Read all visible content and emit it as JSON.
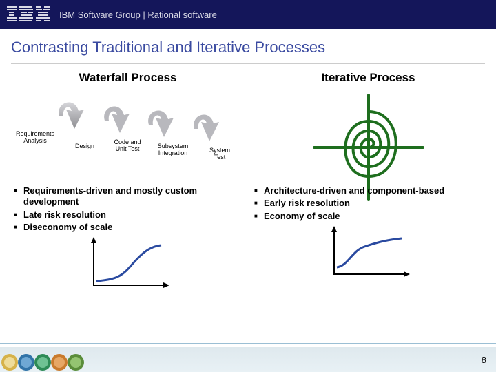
{
  "header": {
    "brand": "IBM",
    "text": "IBM Software Group | Rational software"
  },
  "title": "Contrasting Traditional and Iterative Processes",
  "columns": {
    "left": {
      "heading": "Waterfall Process",
      "phases": [
        "Requirements\nAnalysis",
        "Design",
        "Code and\nUnit Test",
        "Subsystem\nIntegration",
        "System\nTest"
      ],
      "bullets": [
        "Requirements-driven and mostly custom development",
        "Late risk resolution",
        "Diseconomy of scale"
      ]
    },
    "right": {
      "heading": "Iterative Process",
      "bullets": [
        "Architecture-driven and component-based",
        "Early risk resolution",
        "Economy of scale"
      ]
    }
  },
  "page_number": "8",
  "colors": {
    "header_bg": "#14165a",
    "title": "#3a4aa0",
    "spiral": "#1e6e1e",
    "arrow": "#8f8f93",
    "medal_gold": "#d6b24a",
    "medal_blue": "#3274a8",
    "medal_green": "#2e8b57"
  }
}
